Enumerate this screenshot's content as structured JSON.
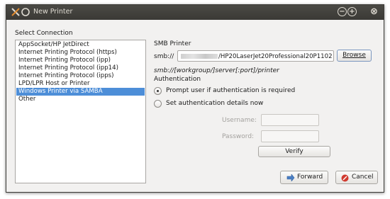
{
  "window": {
    "title": "New Printer",
    "controls": [
      "minimize",
      "maximize",
      "close"
    ]
  },
  "select_connection": {
    "label": "Select Connection",
    "items": [
      "AppSocket/HP JetDirect",
      "Internet Printing Protocol (https)",
      "Internet Printing Protocol (ipp)",
      "Internet Printing Protocol (ipp14)",
      "Internet Printing Protocol (ipps)",
      "LPD/LPR Host or Printer",
      "Windows Printer via SAMBA",
      "Other"
    ],
    "selected_index": 6
  },
  "smb": {
    "heading": "SMB Printer",
    "prefix": "smb://",
    "value_suffix": "/HP20LaserJet20Professional20P1102",
    "browse_label": "Browse",
    "format_hint": "smb://[workgroup/]server[:port]/printer"
  },
  "authentication": {
    "heading": "Authentication",
    "option_prompt": "Prompt user if authentication is required",
    "option_set": "Set authentication details now",
    "username_label": "Username:",
    "password_label": "Password:",
    "verify_label": "Verify"
  },
  "footer": {
    "forward_label": "Forward",
    "cancel_label": "Cancel"
  },
  "colors": {
    "selection": "#4d8ed8",
    "titlebar": "#3c3b37"
  }
}
